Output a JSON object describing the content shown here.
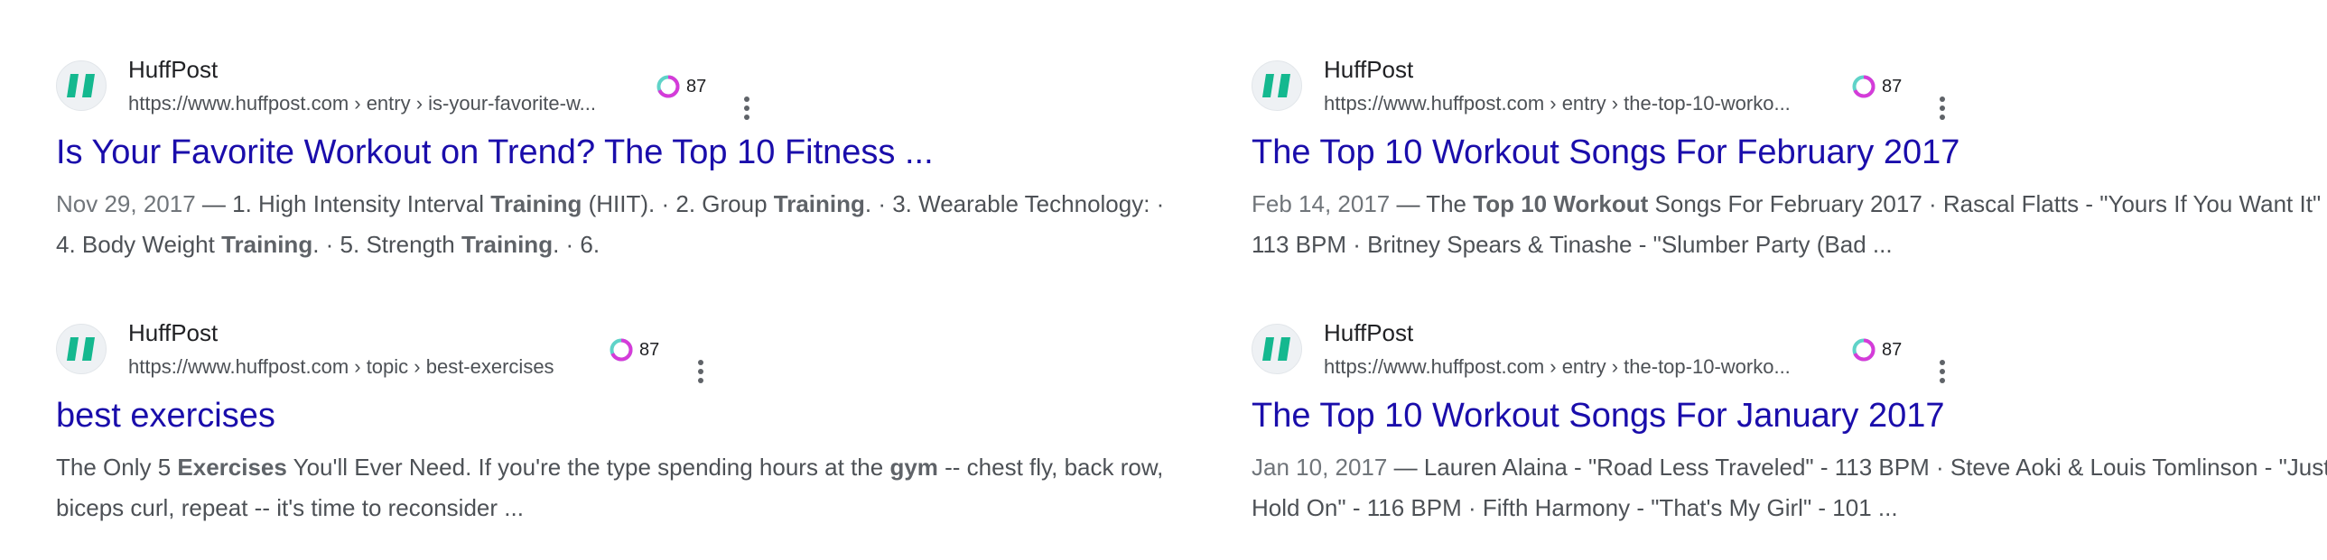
{
  "results": [
    {
      "site_name": "HuffPost",
      "url": "https://www.huffpost.com › entry › is-your-favorite-w...",
      "score": "87",
      "title": "Is Your Favorite Workout on Trend? The Top 10 Fitness ...",
      "date": "Nov 29, 2017",
      "snippet_parts": [
        "1. High Intensity Interval ",
        "Training",
        " (HIIT). · 2. Group ",
        "Training",
        ". · 3. Wearable Technology: · 4. Body Weight ",
        "Training",
        ". · 5. Strength ",
        "Training",
        ". · 6."
      ]
    },
    {
      "site_name": "HuffPost",
      "url": "https://www.huffpost.com › entry › the-top-10-worko...",
      "score": "87",
      "title": "The Top 10 Workout Songs For February 2017",
      "date": "Feb 14, 2017",
      "snippet_parts": [
        "The ",
        "Top 10 Workout",
        " Songs For February 2017 · Rascal Flatts - \"Yours If You Want It\" - 113 BPM · Britney Spears & Tinashe - \"Slumber Party (Bad ..."
      ]
    },
    {
      "site_name": "HuffPost",
      "url": "https://www.huffpost.com › topic › best-exercises",
      "score": "87",
      "title": "best exercises",
      "date": "",
      "snippet_parts": [
        "The Only 5 ",
        "Exercises",
        " You'll Ever Need. If you're the type spending hours at the ",
        "gym",
        " -- chest fly, back row, biceps curl, repeat -- it's time to reconsider ..."
      ]
    },
    {
      "site_name": "HuffPost",
      "url": "https://www.huffpost.com › entry › the-top-10-worko...",
      "score": "87",
      "title": "The Top 10 Workout Songs For January 2017",
      "date": "Jan 10, 2017",
      "snippet_parts": [
        "Lauren Alaina - \"Road Less Traveled\" - 113 BPM · Steve Aoki & Louis Tomlinson - \"Just Hold On\" - 116 BPM · Fifth Harmony - \"That's My Girl\" - 101 ..."
      ]
    }
  ],
  "date_separator": " — ",
  "colors": {
    "title_link": "#1a0dab",
    "snippet_text": "#4d5156",
    "favicon_green": "#14b88f",
    "score_ring_magenta": "#d63bd9",
    "score_ring_teal": "#5fd3c8"
  },
  "icons": {
    "favicon": "huffpost-logo-icon",
    "score": "score-ring-icon",
    "more": "more-vert-icon"
  }
}
